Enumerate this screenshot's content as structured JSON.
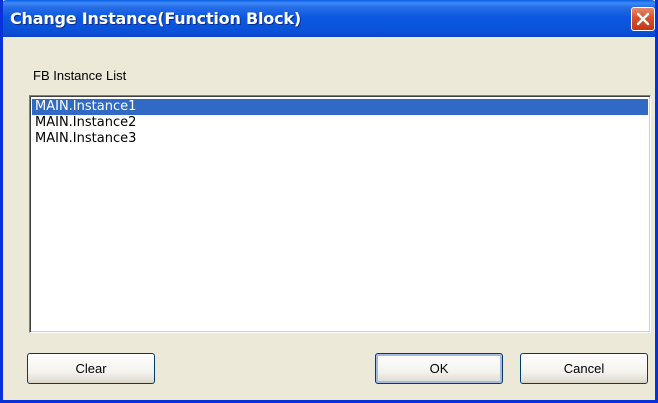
{
  "window": {
    "title": "Change Instance(Function Block)"
  },
  "list": {
    "label": "FB Instance List",
    "items": [
      {
        "label": "MAIN.Instance1",
        "selected": true
      },
      {
        "label": "MAIN.Instance2",
        "selected": false
      },
      {
        "label": "MAIN.Instance3",
        "selected": false
      }
    ]
  },
  "buttons": {
    "clear_label": "Clear",
    "ok_label": "OK",
    "cancel_label": "Cancel"
  },
  "icons": {
    "close": "close-icon"
  },
  "colors": {
    "title_bar": "#0b58e0",
    "close_button": "#d8502e",
    "selection": "#316ac5",
    "dialog_face": "#ece9d8"
  }
}
